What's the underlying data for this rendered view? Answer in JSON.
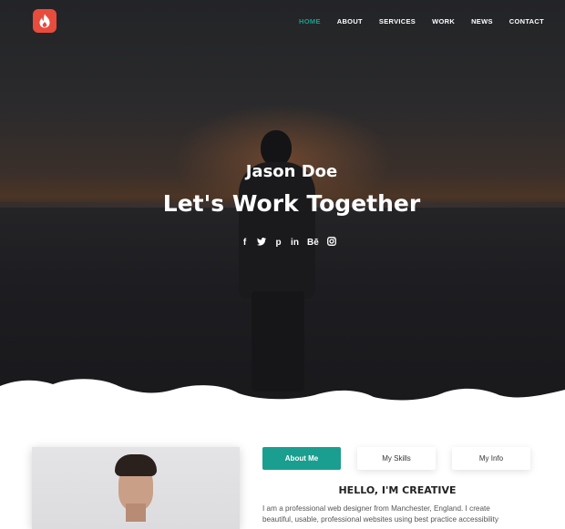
{
  "header": {
    "logo": {
      "icon": "flame-icon",
      "color": "#e84c3d"
    },
    "nav": [
      {
        "label": "HOME",
        "active": true
      },
      {
        "label": "ABOUT",
        "active": false
      },
      {
        "label": "SERVICES",
        "active": false
      },
      {
        "label": "WORK",
        "active": false
      },
      {
        "label": "NEWS",
        "active": false
      },
      {
        "label": "CONTACT",
        "active": false
      }
    ]
  },
  "hero": {
    "name": "Jason Doe",
    "title": "Let's Work Together",
    "social": [
      {
        "icon": "facebook-icon",
        "glyph": "f"
      },
      {
        "icon": "twitter-icon",
        "glyph": "🐦"
      },
      {
        "icon": "pinterest-icon",
        "glyph": "p"
      },
      {
        "icon": "linkedin-icon",
        "glyph": "in"
      },
      {
        "icon": "behance-icon",
        "glyph": "Bē"
      },
      {
        "icon": "instagram-icon",
        "glyph": "◎"
      }
    ]
  },
  "about": {
    "tabs": [
      {
        "label": "About Me",
        "active": true
      },
      {
        "label": "My Skills",
        "active": false
      },
      {
        "label": "My Info",
        "active": false
      }
    ],
    "heading": "HELLO, I'M CREATIVE",
    "text_line1": "I am a professional web designer from Manchester, England. I create",
    "text_line2": "beautiful, usable, professional websites using best practice accessibility"
  },
  "colors": {
    "accent": "#1a9e8f",
    "brand": "#e84c3d"
  }
}
